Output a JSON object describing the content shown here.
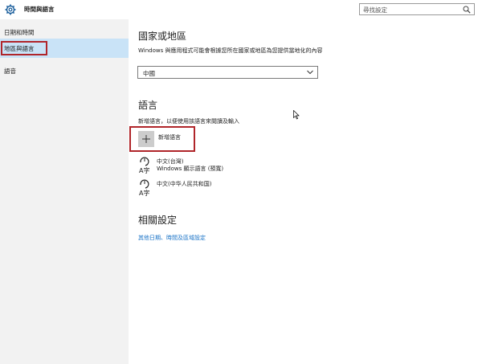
{
  "header": {
    "title": "時間與語言",
    "search_placeholder": "尋找設定"
  },
  "sidebar": {
    "items": [
      {
        "label": "日期和時間"
      },
      {
        "label": "地區與語言"
      },
      {
        "label": "語音"
      }
    ]
  },
  "region": {
    "heading": "國家或地區",
    "description": "Windows 與應用程式可能會根據您所在國家或地區為您提供當地化的內容",
    "selected": "中國"
  },
  "language": {
    "heading": "語言",
    "description": "新增語言，以便使用該語言來閱讀及輸入",
    "add_label": "新增語言",
    "items": [
      {
        "name": "中文(台灣)",
        "sub": "Windows 顯示語言 (預寬)"
      },
      {
        "name": "中文(中华人民共和国)",
        "sub": ""
      }
    ]
  },
  "related": {
    "heading": "相關設定",
    "link": "其他日期、時間及區域設定"
  },
  "colors": {
    "accent": "#1a73c7",
    "selected_bg": "#c9e3f7",
    "highlight": "#b0252a"
  }
}
